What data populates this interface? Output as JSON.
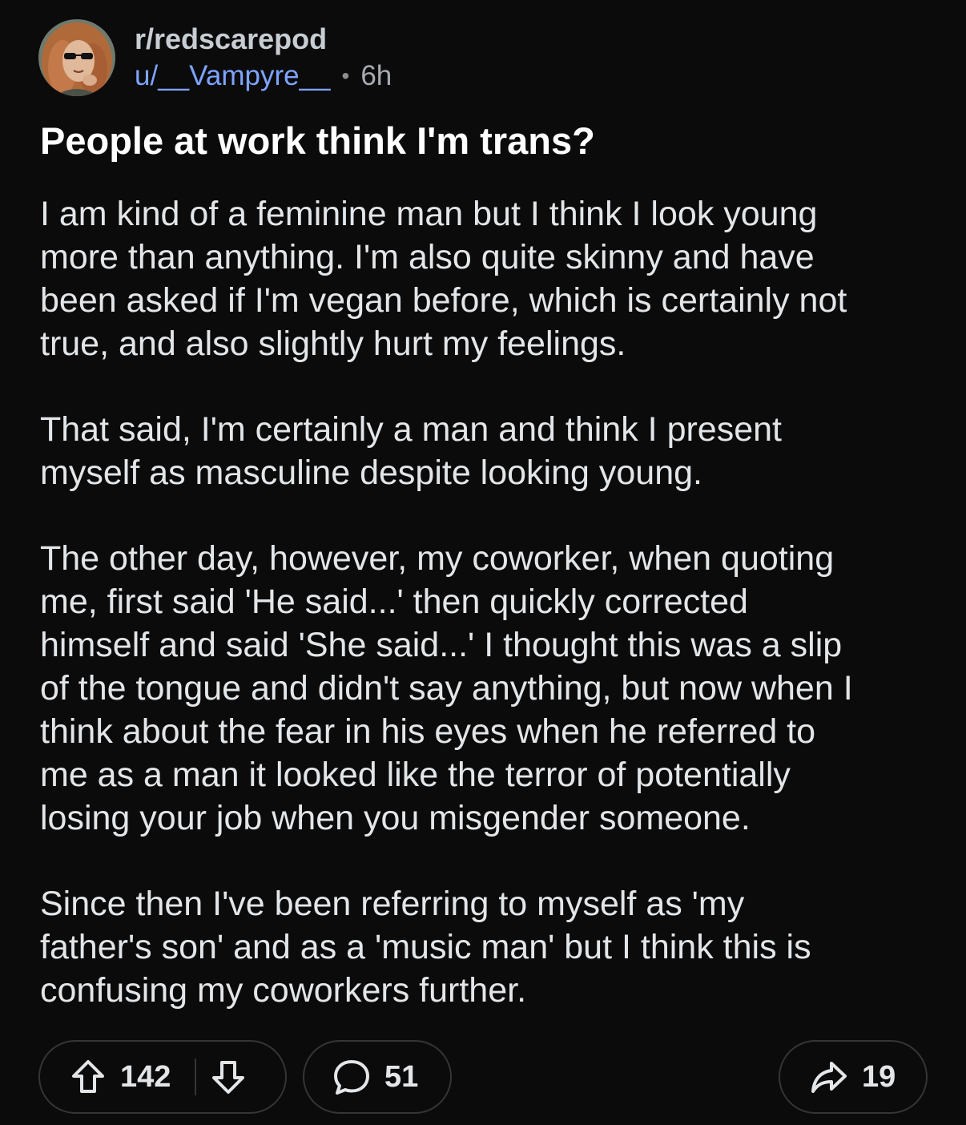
{
  "post": {
    "subreddit": "r/redscarepod",
    "username": "u/__Vampyre__",
    "separator": "•",
    "age": "6h",
    "title": "People at work think I'm trans?",
    "paragraphs": [
      "I am kind of a feminine man but I think I look young\nmore than anything. I'm also quite skinny and have\nbeen asked if I'm vegan before, which is certainly not\ntrue, and also slightly hurt my feelings.",
      "That said, I'm certainly a man and think I present\nmyself as masculine despite looking young.",
      "The other day, however, my coworker, when quoting\nme, first said 'He said...' then quickly corrected\nhimself and said 'She said...' I thought this was a slip\nof the tongue and didn't say anything, but now when I\nthink about the fear in his eyes when he referred to\nme as a man it looked like the terror of potentially\nlosing your job when you misgender someone.",
      "Since then I've been referring to myself as 'my\nfather's son' and as a 'music man' but I think this is\nconfusing my coworkers further."
    ]
  },
  "actions": {
    "upvote_icon": "arrow-up-icon",
    "downvote_icon": "arrow-down-icon",
    "vote_count": "142",
    "comment_icon": "speech-bubble-icon",
    "comment_count": "51",
    "share_icon": "share-arrow-icon",
    "share_count": "19"
  },
  "colors": {
    "background": "#0b0b0c",
    "username": "#7ea4ff",
    "title": "#ffffff",
    "body_text": "#e3e6e8",
    "pill_border": "#343536"
  }
}
